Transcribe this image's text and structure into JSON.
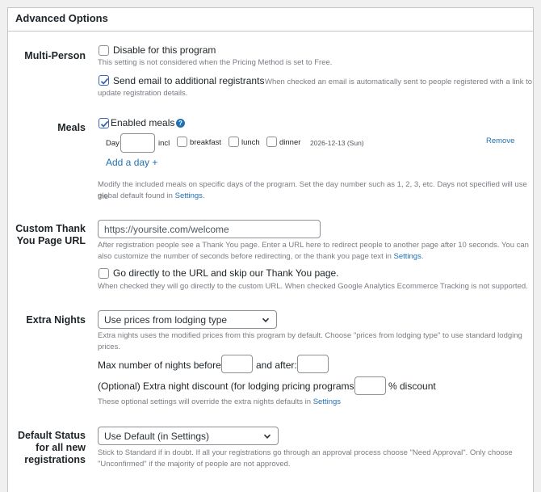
{
  "panel": {
    "title": "Advanced Options"
  },
  "multi_person": {
    "label": "Multi-Person",
    "disable_label": "Disable for this program",
    "disable_desc": "This setting is not considered when the Pricing Method is set to Free.",
    "send_email_label": "Send email to additional registrants",
    "send_email_desc_1": "When checked an email is automatically sent to people registered with a link to",
    "send_email_desc_2": "update registration details."
  },
  "meals": {
    "label": "Meals",
    "enabled_label": "Enabled meals",
    "help_glyph": "?",
    "day_label": "Day",
    "day_value": "",
    "incl_label": "incl",
    "breakfast": "breakfast",
    "lunch": "lunch",
    "dinner": "dinner",
    "date_text": "2026-12-13 (Sun)",
    "remove": "Remove",
    "add_day": "Add a day +",
    "desc_1": "Modify the included meals on specific days of the program. Set the day number such as 1, 2, 3, etc. Days not specified will use the",
    "desc_2": "global default found in",
    "desc_link": "Settings",
    "desc_end": "."
  },
  "thank_you": {
    "label_1": "Custom Thank",
    "label_2": "You Page URL",
    "url_placeholder": "https://yoursite.com/welcome",
    "desc_1": "After registration people see a Thank You page. Enter a URL here to redirect people to another page after 10 seconds. You can",
    "desc_2": "also customize the number of seconds before redirecting, or the thank you page text in",
    "desc_link": "Settings",
    "desc_end": ".",
    "skip_label": "Go directly to the URL and skip our Thank You page.",
    "skip_desc": "When checked they will go directly to the custom URL. When checked Google Analytics Ecommerce Tracking is not supported."
  },
  "extra_nights": {
    "label": "Extra Nights",
    "select_value": "Use prices from lodging type",
    "desc_1": "Extra nights uses the modified prices from this program by default. Choose \"prices from lodging type\" to use standard lodging",
    "desc_2": "prices.",
    "max_before_label": "Max number of nights before:",
    "after_label": "and after:",
    "discount_label": "(Optional) Extra night discount (for lodging pricing programs):",
    "discount_suffix": "% discount",
    "override_desc": "These optional settings will override the extra nights defaults in",
    "override_link": "Settings"
  },
  "default_status": {
    "label_1": "Default Status",
    "label_2": "for all new",
    "label_3": "registrations",
    "select_value": "Use Default (in Settings)",
    "desc_1": "Stick to Standard if in doubt. If all your registrations go through an approval process choose \"Need Approval\". Only choose",
    "desc_2": "\"Unconfirmed\" if the majority of people are not approved."
  },
  "icons": {
    "check": "check-icon",
    "chevron": "chevron-down-icon",
    "help": "help-icon"
  },
  "colors": {
    "link": "#2271b1",
    "checkbox_checked": "#3a66b5",
    "muted_text": "#787c82"
  }
}
